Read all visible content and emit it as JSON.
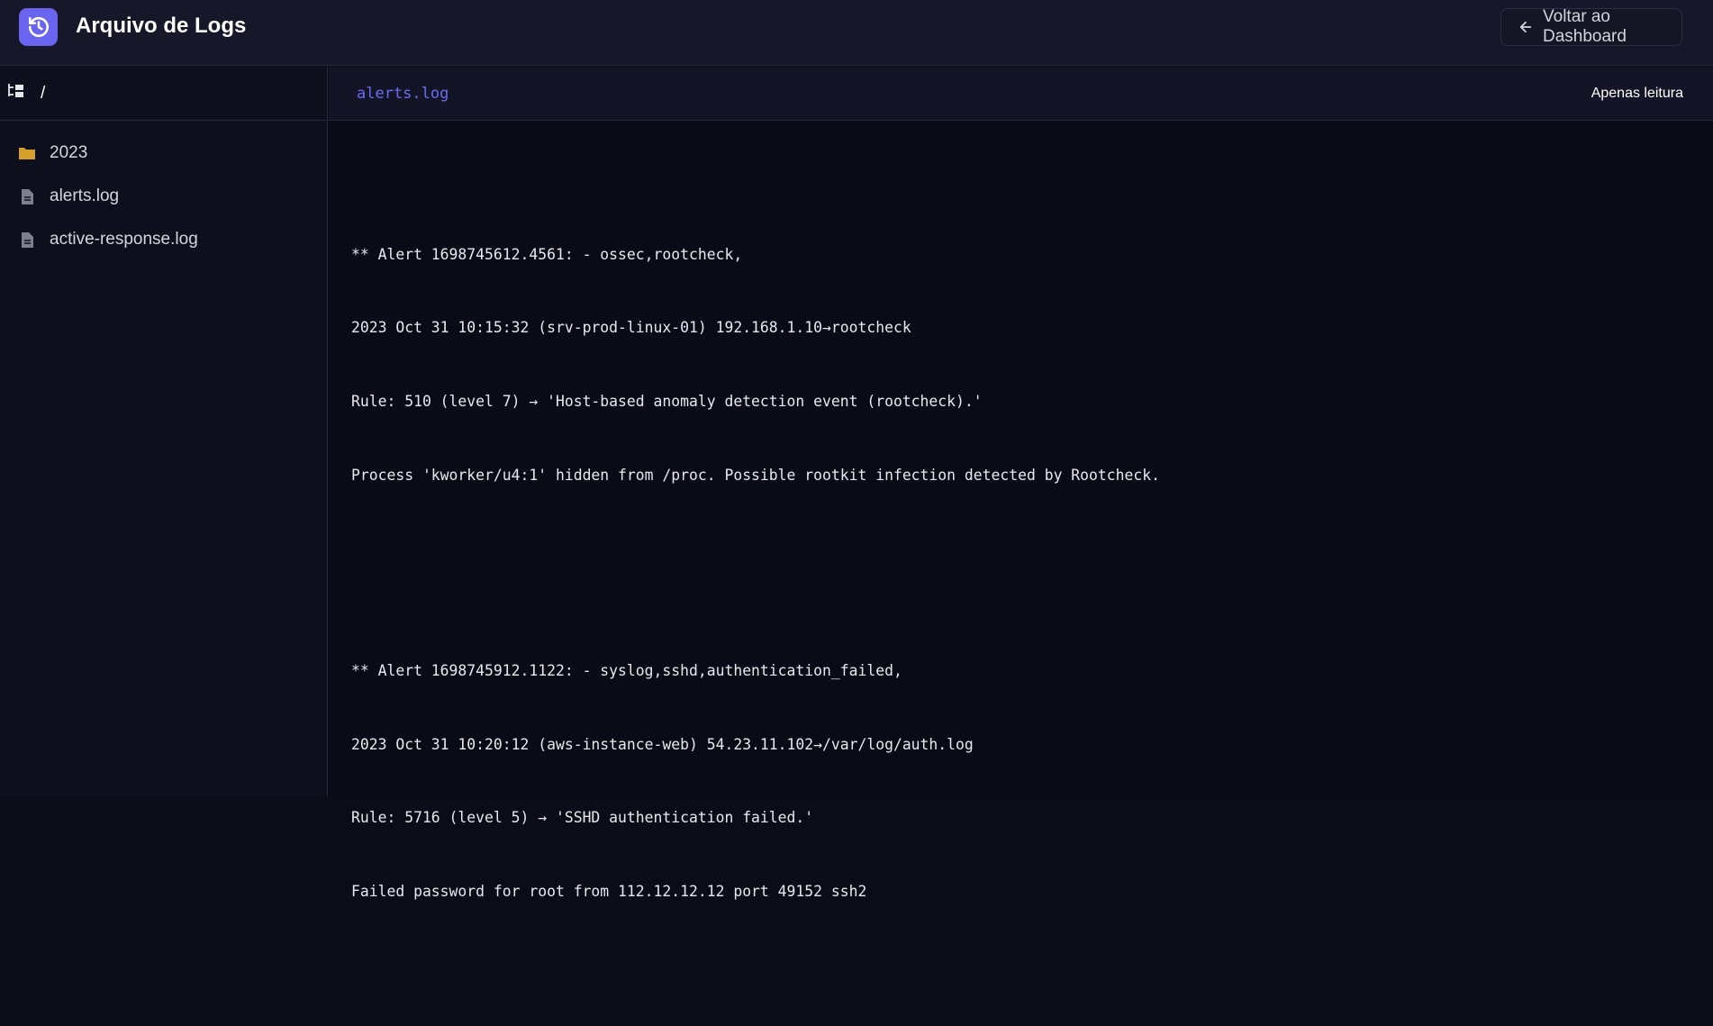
{
  "header": {
    "title": "Arquivo de Logs",
    "back_label": "Voltar ao Dashboard",
    "accent_color": "#6a65f0",
    "logo_icon": "history-icon"
  },
  "sidebar": {
    "path": "/",
    "items": [
      {
        "label": "2023",
        "icon": "folder-icon"
      },
      {
        "label": "alerts.log",
        "icon": "file-icon"
      },
      {
        "label": "active-response.log",
        "icon": "file-icon"
      }
    ]
  },
  "viewer": {
    "file_name": "alerts.log",
    "mode_label": "Apenas leitura",
    "alerts": [
      {
        "lines": [
          "** Alert 1698745612.4561: - ossec,rootcheck,",
          "2023 Oct 31 10:15:32 (srv-prod-linux-01) 192.168.1.10→rootcheck",
          "Rule: 510 (level 7) → 'Host-based anomaly detection event (rootcheck).'",
          "Process 'kworker/u4:1' hidden from /proc. Possible rootkit infection detected by Rootcheck."
        ]
      },
      {
        "lines": [
          "** Alert 1698745912.1122: - syslog,sshd,authentication_failed,",
          "2023 Oct 31 10:20:12 (aws-instance-web) 54.23.11.102→/var/log/auth.log",
          "Rule: 5716 (level 5) → 'SSHD authentication failed.'",
          "Failed password for root from 112.12.12.12 port 49152 ssh2"
        ]
      }
    ]
  }
}
